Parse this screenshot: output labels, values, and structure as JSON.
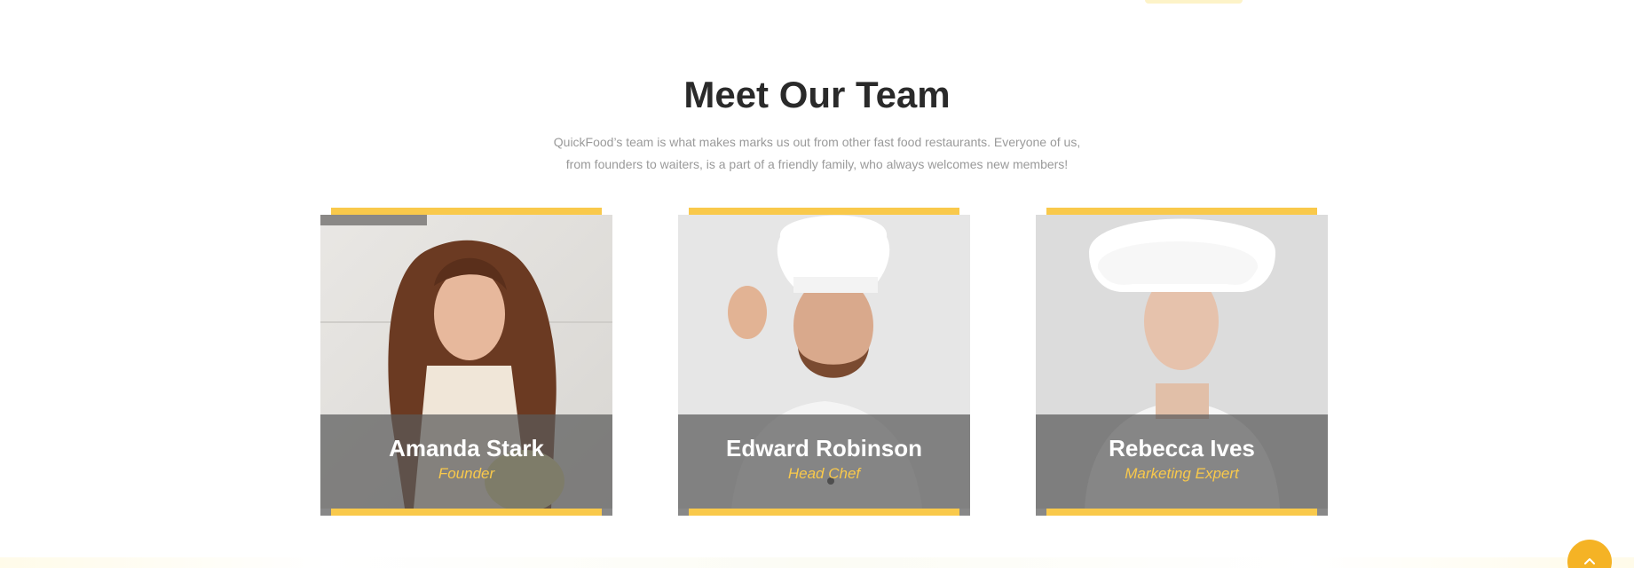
{
  "section": {
    "title": "Meet Our Team",
    "subtitle_line1": "QuickFood’s team is what makes marks us out from other fast food restaurants. Everyone of us,",
    "subtitle_line2": "from founders to waiters, is a part of a friendly family, who always welcomes new members!"
  },
  "team": [
    {
      "name": "Amanda Stark",
      "role": "Founder"
    },
    {
      "name": "Edward Robinson",
      "role": "Head Chef"
    },
    {
      "name": "Rebecca Ives",
      "role": "Marketing Expert"
    }
  ],
  "colors": {
    "accent": "#f9c94b",
    "button": "#f5b325",
    "title": "#2a2a2a",
    "text": "#9a9a9a"
  },
  "icons": {
    "back_to_top": "chevron-up-icon"
  }
}
